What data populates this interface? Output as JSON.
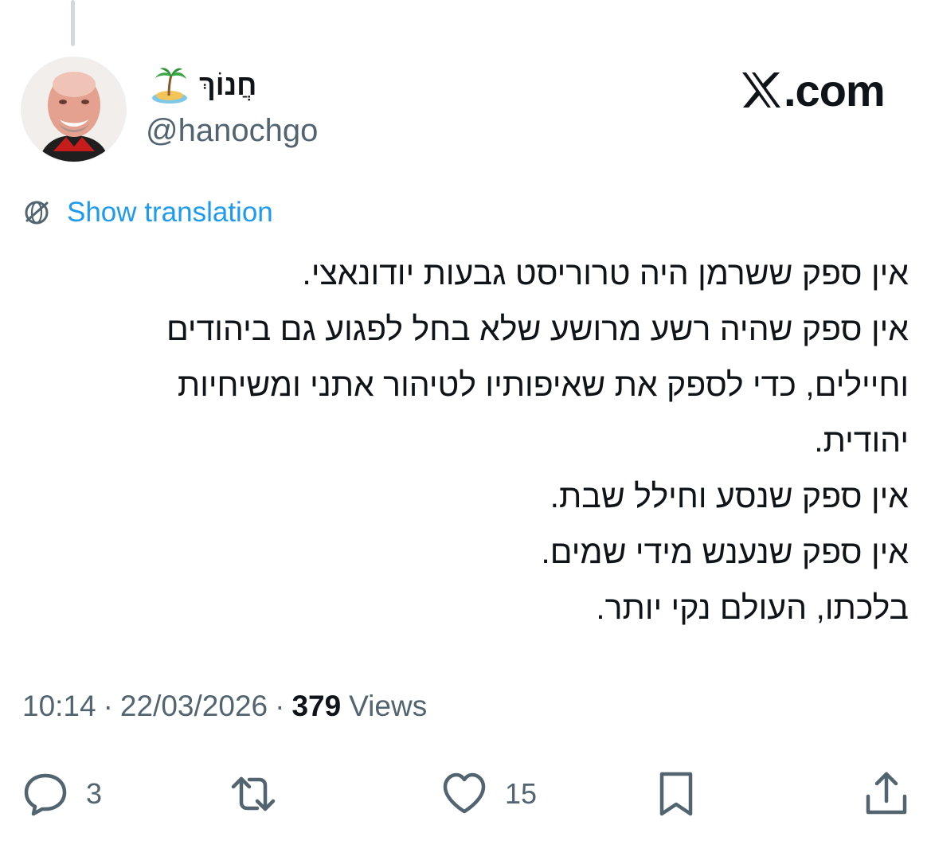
{
  "author": {
    "display_name": "חֲנוֹךְ",
    "badge_emoji_icon": "desert-island-icon",
    "handle": "@hanochgo",
    "avatar_description_icon": "profile-photo"
  },
  "brand": {
    "logo_icon": "x-logo-icon",
    "domain_text": ".com"
  },
  "translation": {
    "icon": "globe-icon",
    "label": "Show translation",
    "color": "#1d9bf0"
  },
  "tweet": {
    "lines": [
      "אין ספק ששרמן היה טרוריסט גבעות יודונאצי.",
      "אין ספק שהיה רשע מרושע שלא בחל לפגוע גם ביהודים",
      "וחיילים, כדי לספק את שאיפותיו לטיהור אתני ומשיחיות",
      "יהודית.",
      "אין ספק שנסע וחילל שבת.",
      "אין ספק שנענש מידי שמים.",
      "בלכתו, העולם נקי יותר."
    ]
  },
  "meta": {
    "time": "10:14",
    "date": "22/03/2026",
    "views_count": "379",
    "views_label": "Views",
    "separator": "·"
  },
  "actions": {
    "reply": {
      "icon": "reply-icon",
      "count": "3"
    },
    "repost": {
      "icon": "repost-icon",
      "count": ""
    },
    "like": {
      "icon": "heart-icon",
      "count": "15"
    },
    "bookmark": {
      "icon": "bookmark-icon",
      "count": ""
    },
    "share": {
      "icon": "share-icon",
      "count": ""
    }
  },
  "colors": {
    "text_primary": "#0f1419",
    "text_secondary": "#536471",
    "link_blue": "#1d9bf0",
    "thread_line": "#cfd9de"
  }
}
